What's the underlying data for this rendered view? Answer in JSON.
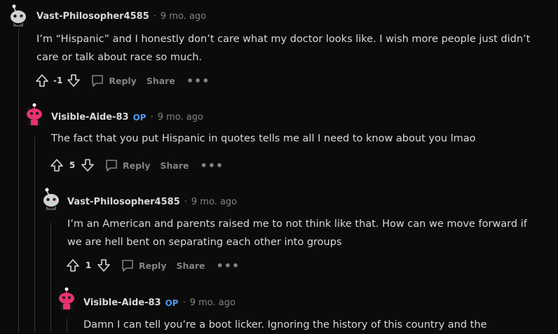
{
  "comments": [
    {
      "author": "Vast-Philosopher4585",
      "op": "",
      "sep": "·",
      "time": "9 mo. ago",
      "text": "I’m “Hispanic” and I honestly don’t care what my doctor looks like. I wish more people just didn’t care or talk about race so much.",
      "score": "-1",
      "reply": "Reply",
      "share": "Share",
      "more": "•••",
      "avatar": "snoo-grey-avatar"
    },
    {
      "author": "Visible-Aide-83",
      "op": "OP",
      "sep": "·",
      "time": "9 mo. ago",
      "text": "The fact that you put Hispanic in quotes tells me all I need to know about you lmao",
      "score": "5",
      "reply": "Reply",
      "share": "Share",
      "more": "•••",
      "avatar": "snoo-pink-avatar"
    },
    {
      "author": "Vast-Philosopher4585",
      "op": "",
      "sep": "·",
      "time": "9 mo. ago",
      "text": "I’m an American and parents raised me to not think like that. How can we move forward if we are hell bent on separating each other into groups",
      "score": "1",
      "reply": "Reply",
      "share": "Share",
      "more": "•••",
      "avatar": "snoo-grey-avatar"
    },
    {
      "author": "Visible-Aide-83",
      "op": "OP",
      "sep": "·",
      "time": "9 mo. ago",
      "text": "Damn I can tell you’re a boot licker. Ignoring the history of this country and the",
      "avatar": "snoo-pink-avatar"
    }
  ],
  "colors": {
    "op_badge": "#4f9bf3",
    "pink_snoo": "#e8336c",
    "grey_snoo": "#cfd2d4",
    "muted": "#818384"
  }
}
